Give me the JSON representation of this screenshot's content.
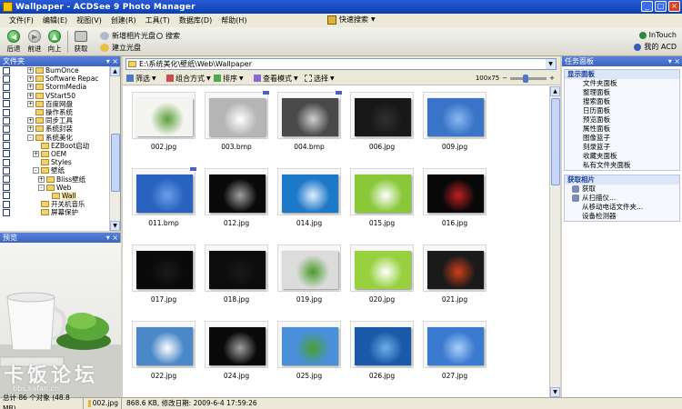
{
  "window": {
    "title": "Wallpaper - ACDSee 9 Photo Manager"
  },
  "menu": {
    "items": [
      "文件(F)",
      "编辑(E)",
      "视图(V)",
      "创建(R)",
      "工具(T)",
      "数据库(D)",
      "帮助(H)"
    ],
    "shortcut": "快速搜索"
  },
  "toolbar": {
    "back": "后退",
    "forward": "前进",
    "up": "向上",
    "acquire": "获取",
    "new_disc": "新增相片光盘",
    "search": "搜索",
    "burn": "建立光盘",
    "intouch": "InTouch",
    "my_acd": "我的 ACD"
  },
  "left_panel": {
    "title": "文件夹",
    "tree": [
      {
        "label": "BumOnce",
        "indent": 3,
        "pm": "+"
      },
      {
        "label": "Software Repac",
        "indent": 3,
        "pm": "+"
      },
      {
        "label": "StormMedia",
        "indent": 3,
        "pm": "+"
      },
      {
        "label": "VStart50",
        "indent": 3,
        "pm": "+"
      },
      {
        "label": "百度网盘",
        "indent": 3,
        "pm": "+"
      },
      {
        "label": "操作系统",
        "indent": 3,
        "pm": ""
      },
      {
        "label": "同步工具",
        "indent": 3,
        "pm": "+"
      },
      {
        "label": "系统封装",
        "indent": 3,
        "pm": "+"
      },
      {
        "label": "系统美化",
        "indent": 3,
        "pm": "-"
      },
      {
        "label": "EZBoot启动",
        "indent": 4,
        "pm": ""
      },
      {
        "label": "OEM",
        "indent": 4,
        "pm": "+"
      },
      {
        "label": "Styles",
        "indent": 4,
        "pm": ""
      },
      {
        "label": "壁纸",
        "indent": 4,
        "pm": "-"
      },
      {
        "label": "Bliss壁纸",
        "indent": 5,
        "pm": "+"
      },
      {
        "label": "Web",
        "indent": 5,
        "pm": "-"
      },
      {
        "label": "Wall",
        "indent": 6,
        "pm": "",
        "selected": true
      },
      {
        "label": "开关机音乐",
        "indent": 4,
        "pm": ""
      },
      {
        "label": "屏幕保护",
        "indent": 4,
        "pm": ""
      }
    ]
  },
  "preview_panel": {
    "title": "预览"
  },
  "main": {
    "path": "E:\\系统美化\\壁纸\\Web\\Wallpaper",
    "filter": "筛选",
    "group": "组合方式",
    "sort": "排序",
    "view": "查看模式",
    "select": "选择",
    "zoom": "100x75",
    "thumbnails": [
      {
        "name": "002.jpg",
        "color": "#f4f4f0",
        "accent": "#5aa03a",
        "badge": false
      },
      {
        "name": "003.bmp",
        "color": "#b5b5b5",
        "accent": "#ffffff",
        "badge": true
      },
      {
        "name": "004.bmp",
        "color": "#4a4a4a",
        "accent": "#d0d0d0",
        "badge": true
      },
      {
        "name": "006.jpg",
        "color": "#181818",
        "accent": "#303030",
        "badge": false
      },
      {
        "name": "009.jpg",
        "color": "#3a74c8",
        "accent": "#8ab8f0",
        "badge": false
      },
      {
        "name": "011.bmp",
        "color": "#2a62c0",
        "accent": "#6aa0e8",
        "badge": true
      },
      {
        "name": "012.jpg",
        "color": "#0a0a0a",
        "accent": "#a0a0a0",
        "badge": false
      },
      {
        "name": "014.jpg",
        "color": "#1e78c8",
        "accent": "#e0f0ff",
        "badge": false
      },
      {
        "name": "015.jpg",
        "color": "#8ac83a",
        "accent": "#ffffff",
        "badge": false
      },
      {
        "name": "016.jpg",
        "color": "#080808",
        "accent": "#c02020",
        "badge": false
      },
      {
        "name": "017.jpg",
        "color": "#0a0a0a",
        "accent": "#1a1a1a",
        "badge": false
      },
      {
        "name": "018.jpg",
        "color": "#0c0c0c",
        "accent": "#1a1a1a",
        "badge": false
      },
      {
        "name": "019.jpg",
        "color": "#dcdcdc",
        "accent": "#4a9a2a",
        "badge": false
      },
      {
        "name": "020.jpg",
        "color": "#98d040",
        "accent": "#ffffff",
        "badge": false
      },
      {
        "name": "021.jpg",
        "color": "#1a1a1a",
        "accent": "#d04018",
        "badge": false
      },
      {
        "name": "022.jpg",
        "color": "#4a88c8",
        "accent": "#ffffff",
        "badge": false
      },
      {
        "name": "024.jpg",
        "color": "#0a0a0a",
        "accent": "#a0a0a0",
        "badge": false
      },
      {
        "name": "025.jpg",
        "color": "#4a90d8",
        "accent": "#4aa030",
        "badge": false
      },
      {
        "name": "026.jpg",
        "color": "#1a5aa8",
        "accent": "#6ab0e8",
        "badge": false
      },
      {
        "name": "027.jpg",
        "color": "#3a7ad0",
        "accent": "#a8d0f8",
        "badge": false
      }
    ]
  },
  "right_panel": {
    "title": "任务面板",
    "section1": "显示面板",
    "panels": [
      "文件夹面板",
      "整理面板",
      "搜索面板",
      "日历面板",
      "预览面板",
      "属性面板",
      "图像篮子",
      "刻录篮子",
      "收藏夹面板",
      "私有文件夹面板"
    ],
    "section2": "获取相片",
    "acquire": [
      "获取",
      "从扫描仪...",
      "从移动电话文件夹...",
      "设备检测器"
    ]
  },
  "status": {
    "total": "总计 86 个对象 (48.8 MB)",
    "file": "002.jpg",
    "info": "868.6 KB, 修改日期: 2009-6-4 17:59:26"
  },
  "watermark": {
    "main": "卡饭论坛",
    "url": "bbs.kafan.cn"
  }
}
